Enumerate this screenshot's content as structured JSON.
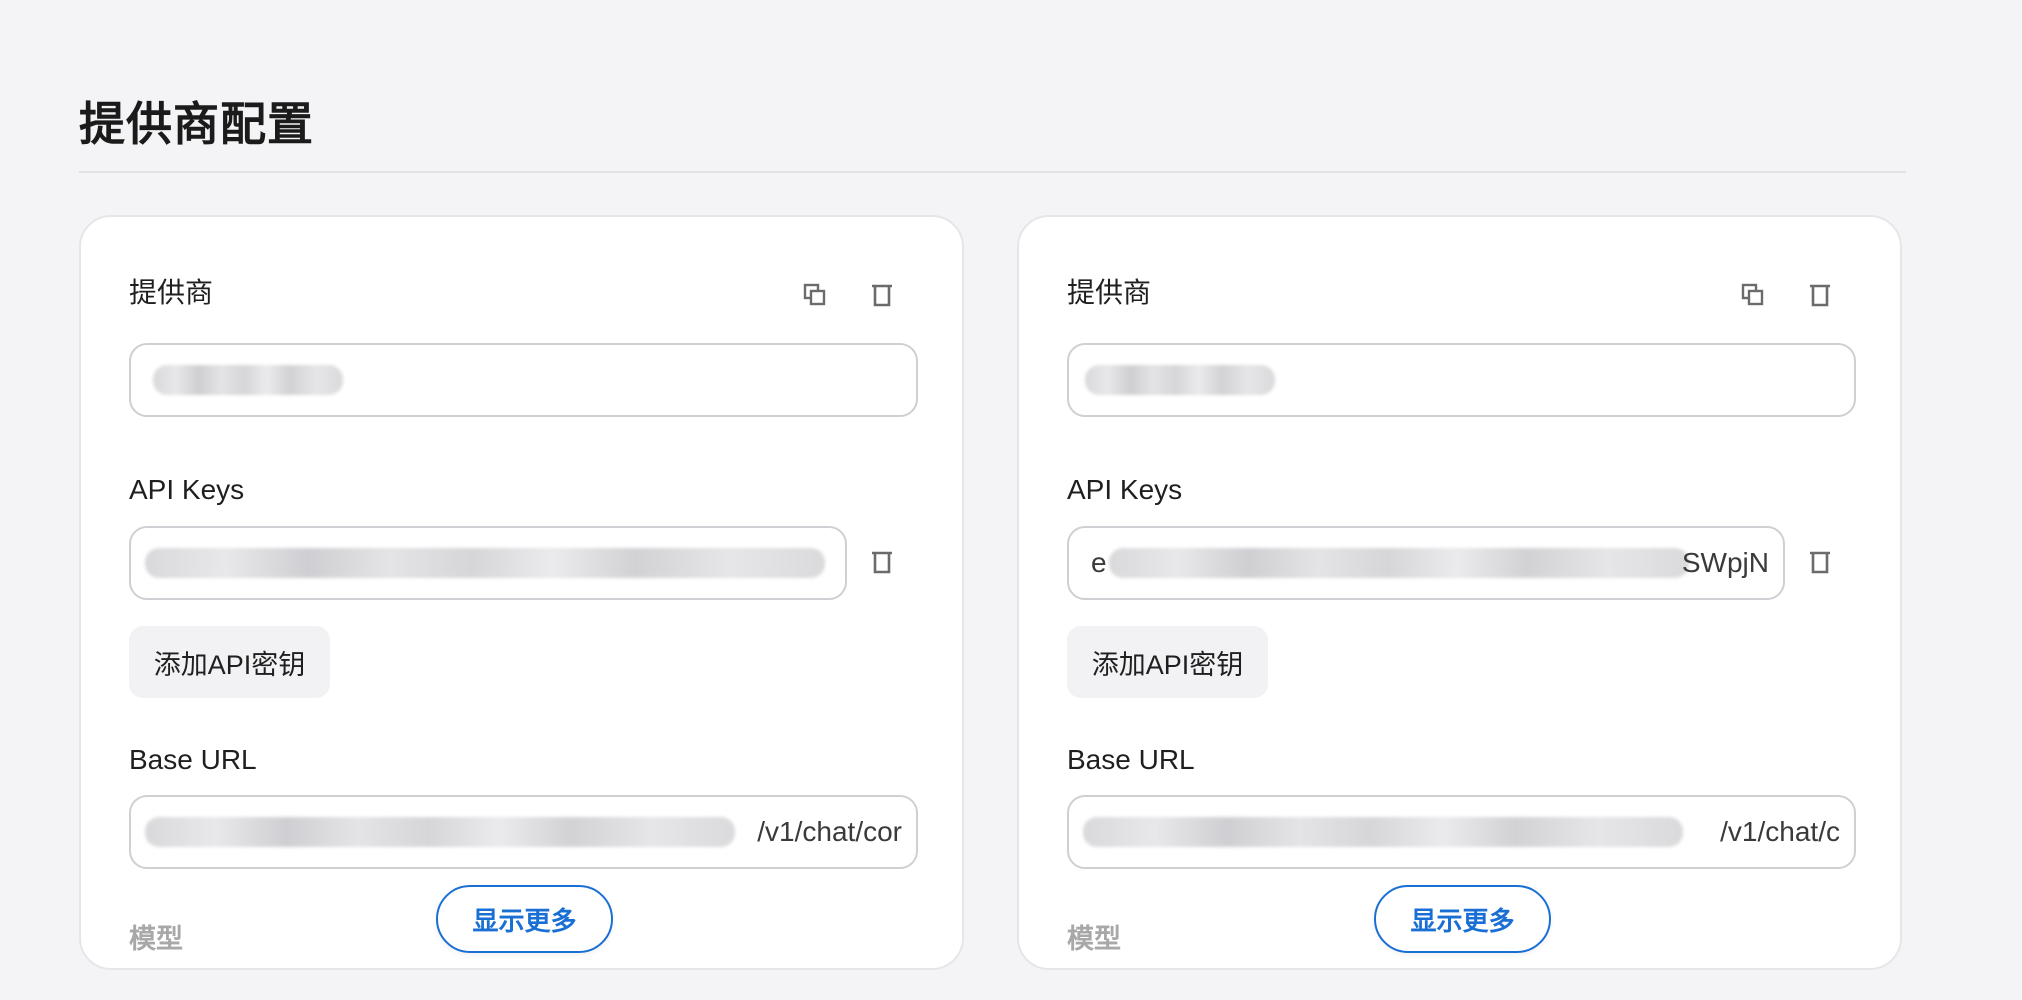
{
  "page": {
    "title": "提供商配置"
  },
  "cards": [
    {
      "provider_label": "提供商",
      "provider_value": "",
      "api_keys_label": "API Keys",
      "api_key_suffix": "",
      "add_key_label": "添加API密钥",
      "base_url_label": "Base URL",
      "base_url_suffix": "/v1/chat/cor",
      "model_label": "模型",
      "show_more_label": "显示更多"
    },
    {
      "provider_label": "提供商",
      "provider_value": "",
      "api_keys_label": "API Keys",
      "api_key_prefix": "e",
      "api_key_suffix": "SWpjN",
      "add_key_label": "添加API密钥",
      "base_url_label": "Base URL",
      "base_url_suffix": "/v1/chat/c",
      "model_label": "模型",
      "show_more_label": "显示更多"
    }
  ],
  "icons": {
    "copy": "copy-icon",
    "delete": "trash-icon"
  },
  "colors": {
    "accent": "#1a6fd4",
    "background": "#f4f4f6",
    "card": "#ffffff"
  }
}
